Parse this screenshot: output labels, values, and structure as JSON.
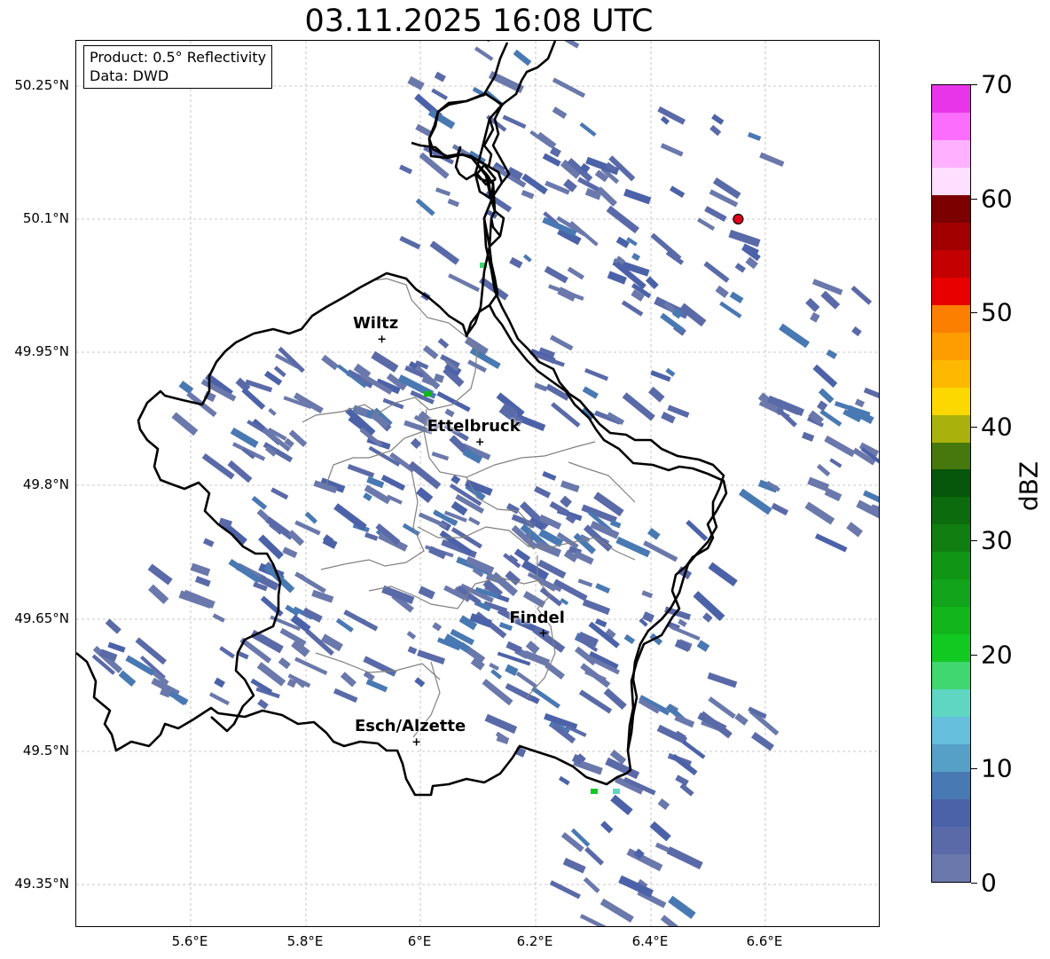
{
  "title": "03.11.2025 16:08 UTC",
  "info_box": {
    "product": "Product: 0.5° Reflectivity",
    "data": "Data: DWD"
  },
  "lat_labels": [
    "50.25°N",
    "50.1°N",
    "49.95°N",
    "49.8°N",
    "49.65°N",
    "49.5°N",
    "49.35°N"
  ],
  "lon_labels": [
    "5.6°E",
    "5.8°E",
    "6°E",
    "6.2°E",
    "6.4°E",
    "6.6°E"
  ],
  "cities": [
    {
      "name": "Wiltz",
      "lon": 5.93,
      "lat": 49.97
    },
    {
      "name": "Ettelbruck",
      "lon": 6.1,
      "lat": 49.85
    },
    {
      "name": "Findel",
      "lon": 6.21,
      "lat": 49.627
    },
    {
      "name": "Esch/Alzette",
      "lon": 5.99,
      "lat": 49.5
    }
  ],
  "radar_site": {
    "lon": 6.548,
    "lat": 50.11,
    "color": "#e4001b"
  },
  "colorbar": {
    "unit": "dBZ",
    "tick_labels": [
      "0",
      "10",
      "20",
      "30",
      "40",
      "50",
      "60",
      "70"
    ],
    "colors": [
      "#6a78ab",
      "#5a6aa8",
      "#4c62a8",
      "#4979b2",
      "#56a0c8",
      "#66bfdc",
      "#5fd6c2",
      "#40d670",
      "#12c922",
      "#12b61a",
      "#12a41a",
      "#119515",
      "#107e10",
      "#0c6b0c",
      "#06560c",
      "#46780e",
      "#a9b20c",
      "#fdd800",
      "#fdb800",
      "#fd9d00",
      "#fd7f00",
      "#e80000",
      "#c40000",
      "#a20000",
      "#7c0000",
      "#ffdfff",
      "#ffb1ff",
      "#fd6dfd",
      "#e935e9"
    ]
  },
  "extent": {
    "lon_min": 5.4,
    "lon_max": 6.795,
    "lat_min": 49.283,
    "lat_max": 50.318
  }
}
